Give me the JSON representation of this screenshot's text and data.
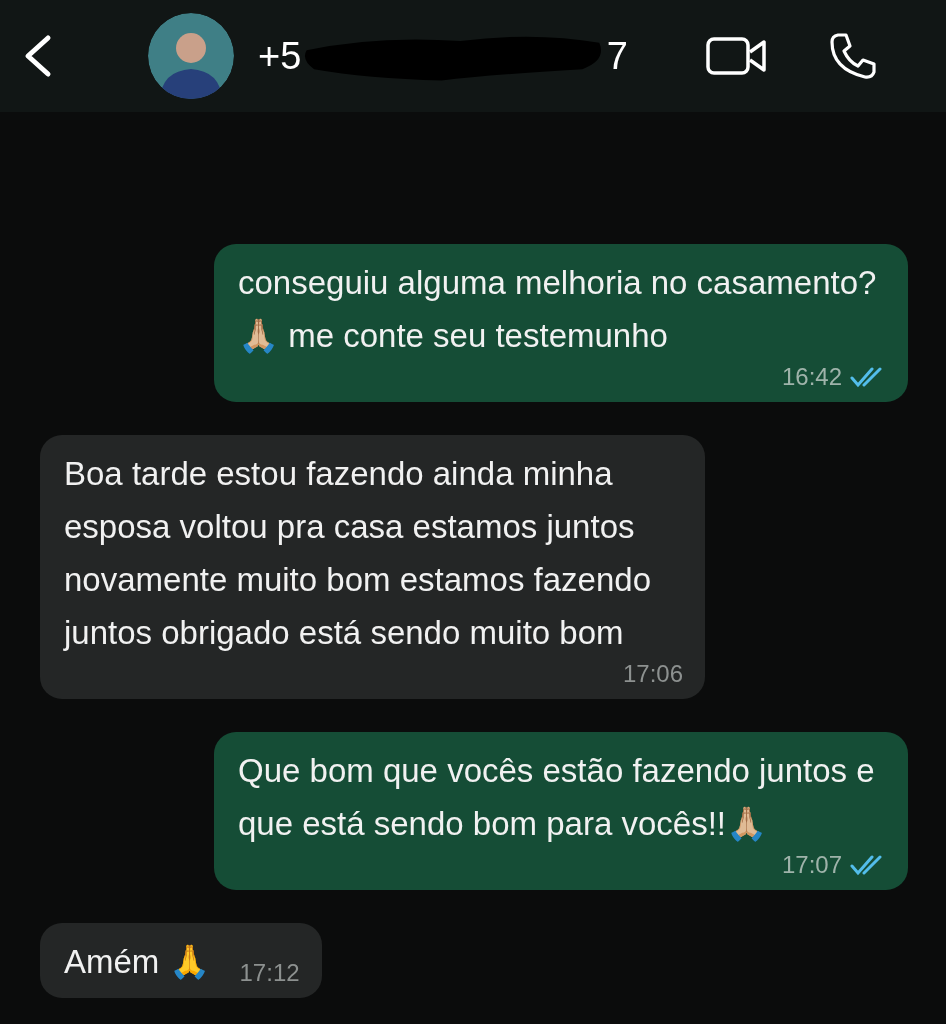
{
  "header": {
    "name_start": "+5",
    "name_end": "7"
  },
  "messages": [
    {
      "kind": "out",
      "text": "conseguiu alguma melhoria no casamento?🙏🏼 me conte seu testemunho",
      "time": "16:42",
      "read": true
    },
    {
      "kind": "in",
      "text": "Boa tarde estou fazendo ainda minha esposa voltou pra casa estamos juntos novamente muito bom estamos fazendo juntos obrigado está sendo muito bom",
      "time": "17:06"
    },
    {
      "kind": "out",
      "text": "Que bom que vocês estão fazendo juntos e que está sendo bom para vocês!!🙏🏼",
      "time": "17:07",
      "read": true
    },
    {
      "kind": "in",
      "text": "Amém 🙏",
      "time": "17:12"
    }
  ]
}
